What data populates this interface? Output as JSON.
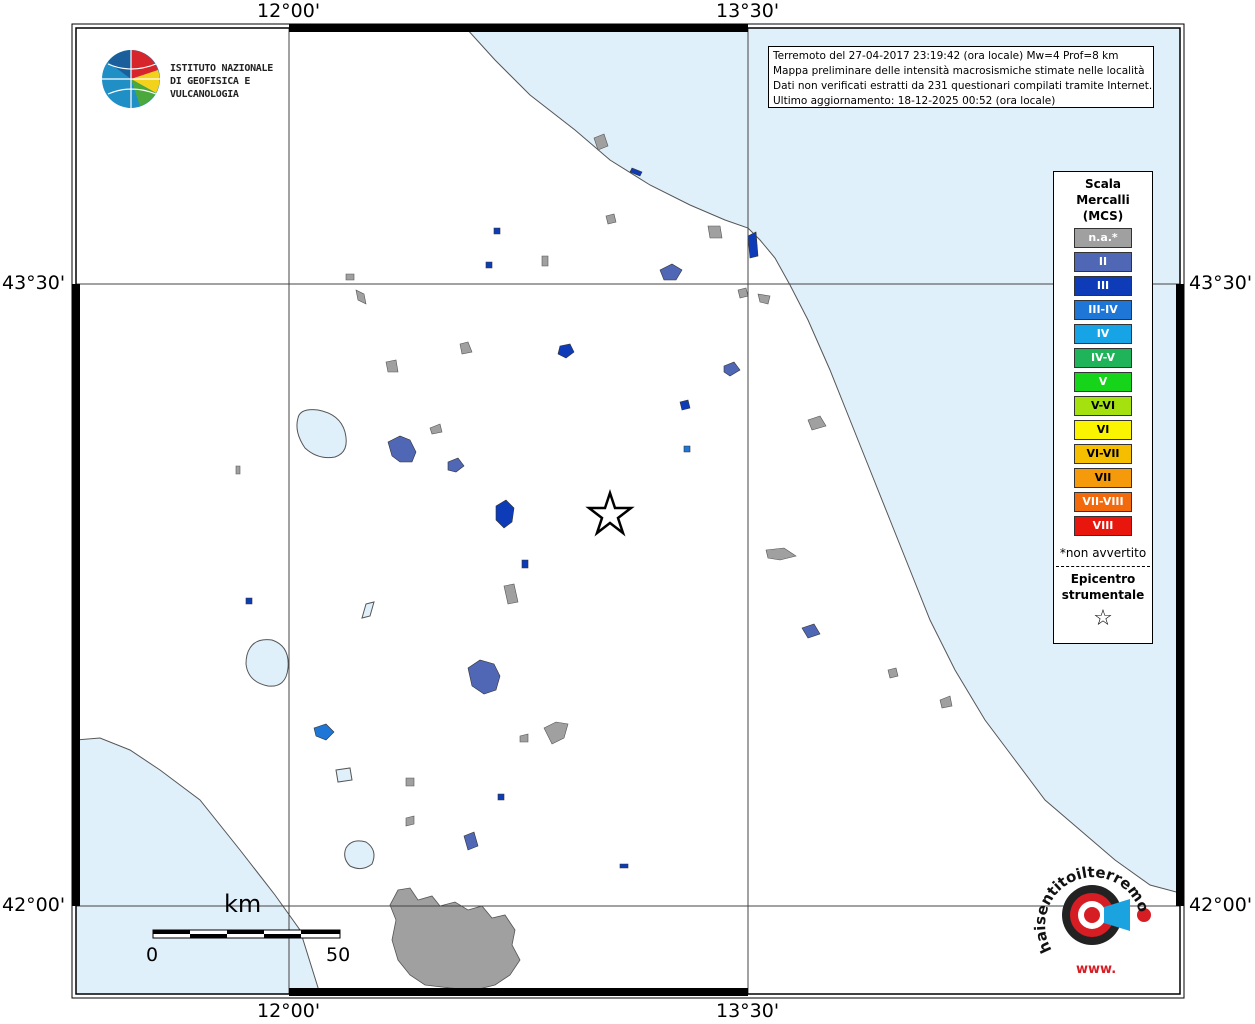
{
  "map": {
    "lon_labels": [
      "12°00'",
      "13°30'"
    ],
    "lat_labels": [
      "43°30'",
      "42°00'"
    ],
    "colors": {
      "sea": "#dff0fb",
      "land": "#ffffff",
      "grid": "#444444",
      "not_felt": "#a0a0a0",
      "mcs_II": "#4f67b5",
      "mcs_III": "#0e3cb9",
      "mcs_III_IV": "#1e76d6"
    }
  },
  "info": {
    "line1": "Terremoto del 27-04-2017 23:19:42 (ora locale) Mw=4 Prof=8 km",
    "line2": "Mappa preliminare delle intensità macrosismiche stimate nelle località",
    "line3": "Dati non verificati estratti da 231 questionari compilati tramite Internet.",
    "line4": "Ultimo aggiornamento: 18-12-2025 00:52 (ora locale)"
  },
  "ingv_logo": {
    "line1": "ISTITUTO NAZIONALE",
    "line2": "DI GEOFISICA E VULCANOLOGIA"
  },
  "legend": {
    "title_1": "Scala",
    "title_2": "Mercalli",
    "title_3": "(MCS)",
    "items": [
      {
        "label": "n.a.*",
        "color": "#a0a0a0"
      },
      {
        "label": "II",
        "color": "#4f67b5"
      },
      {
        "label": "III",
        "color": "#0e3cb9"
      },
      {
        "label": "III-IV",
        "color": "#1e76d6"
      },
      {
        "label": "IV",
        "color": "#17a4e6"
      },
      {
        "label": "IV-V",
        "color": "#1fb45a"
      },
      {
        "label": "V",
        "color": "#16d41a"
      },
      {
        "label": "V-VI",
        "color": "#a4e10e"
      },
      {
        "label": "VI",
        "color": "#fbf400"
      },
      {
        "label": "VI-VII",
        "color": "#f5bf00"
      },
      {
        "label": "VII",
        "color": "#f59a0a"
      },
      {
        "label": "VII-VIII",
        "color": "#f26a0c"
      },
      {
        "label": "VIII",
        "color": "#e8160c"
      }
    ],
    "not_felt_note": "*non avvertito",
    "epicenter_1": "Epicentro",
    "epicenter_2": "strumentale",
    "epicenter_symbol": "☆"
  },
  "scalebar": {
    "unit": "km",
    "start": "0",
    "end": "50"
  },
  "haisentito_logo": {
    "text": "haisentitoilterremoto.it",
    "url_text": "www."
  }
}
